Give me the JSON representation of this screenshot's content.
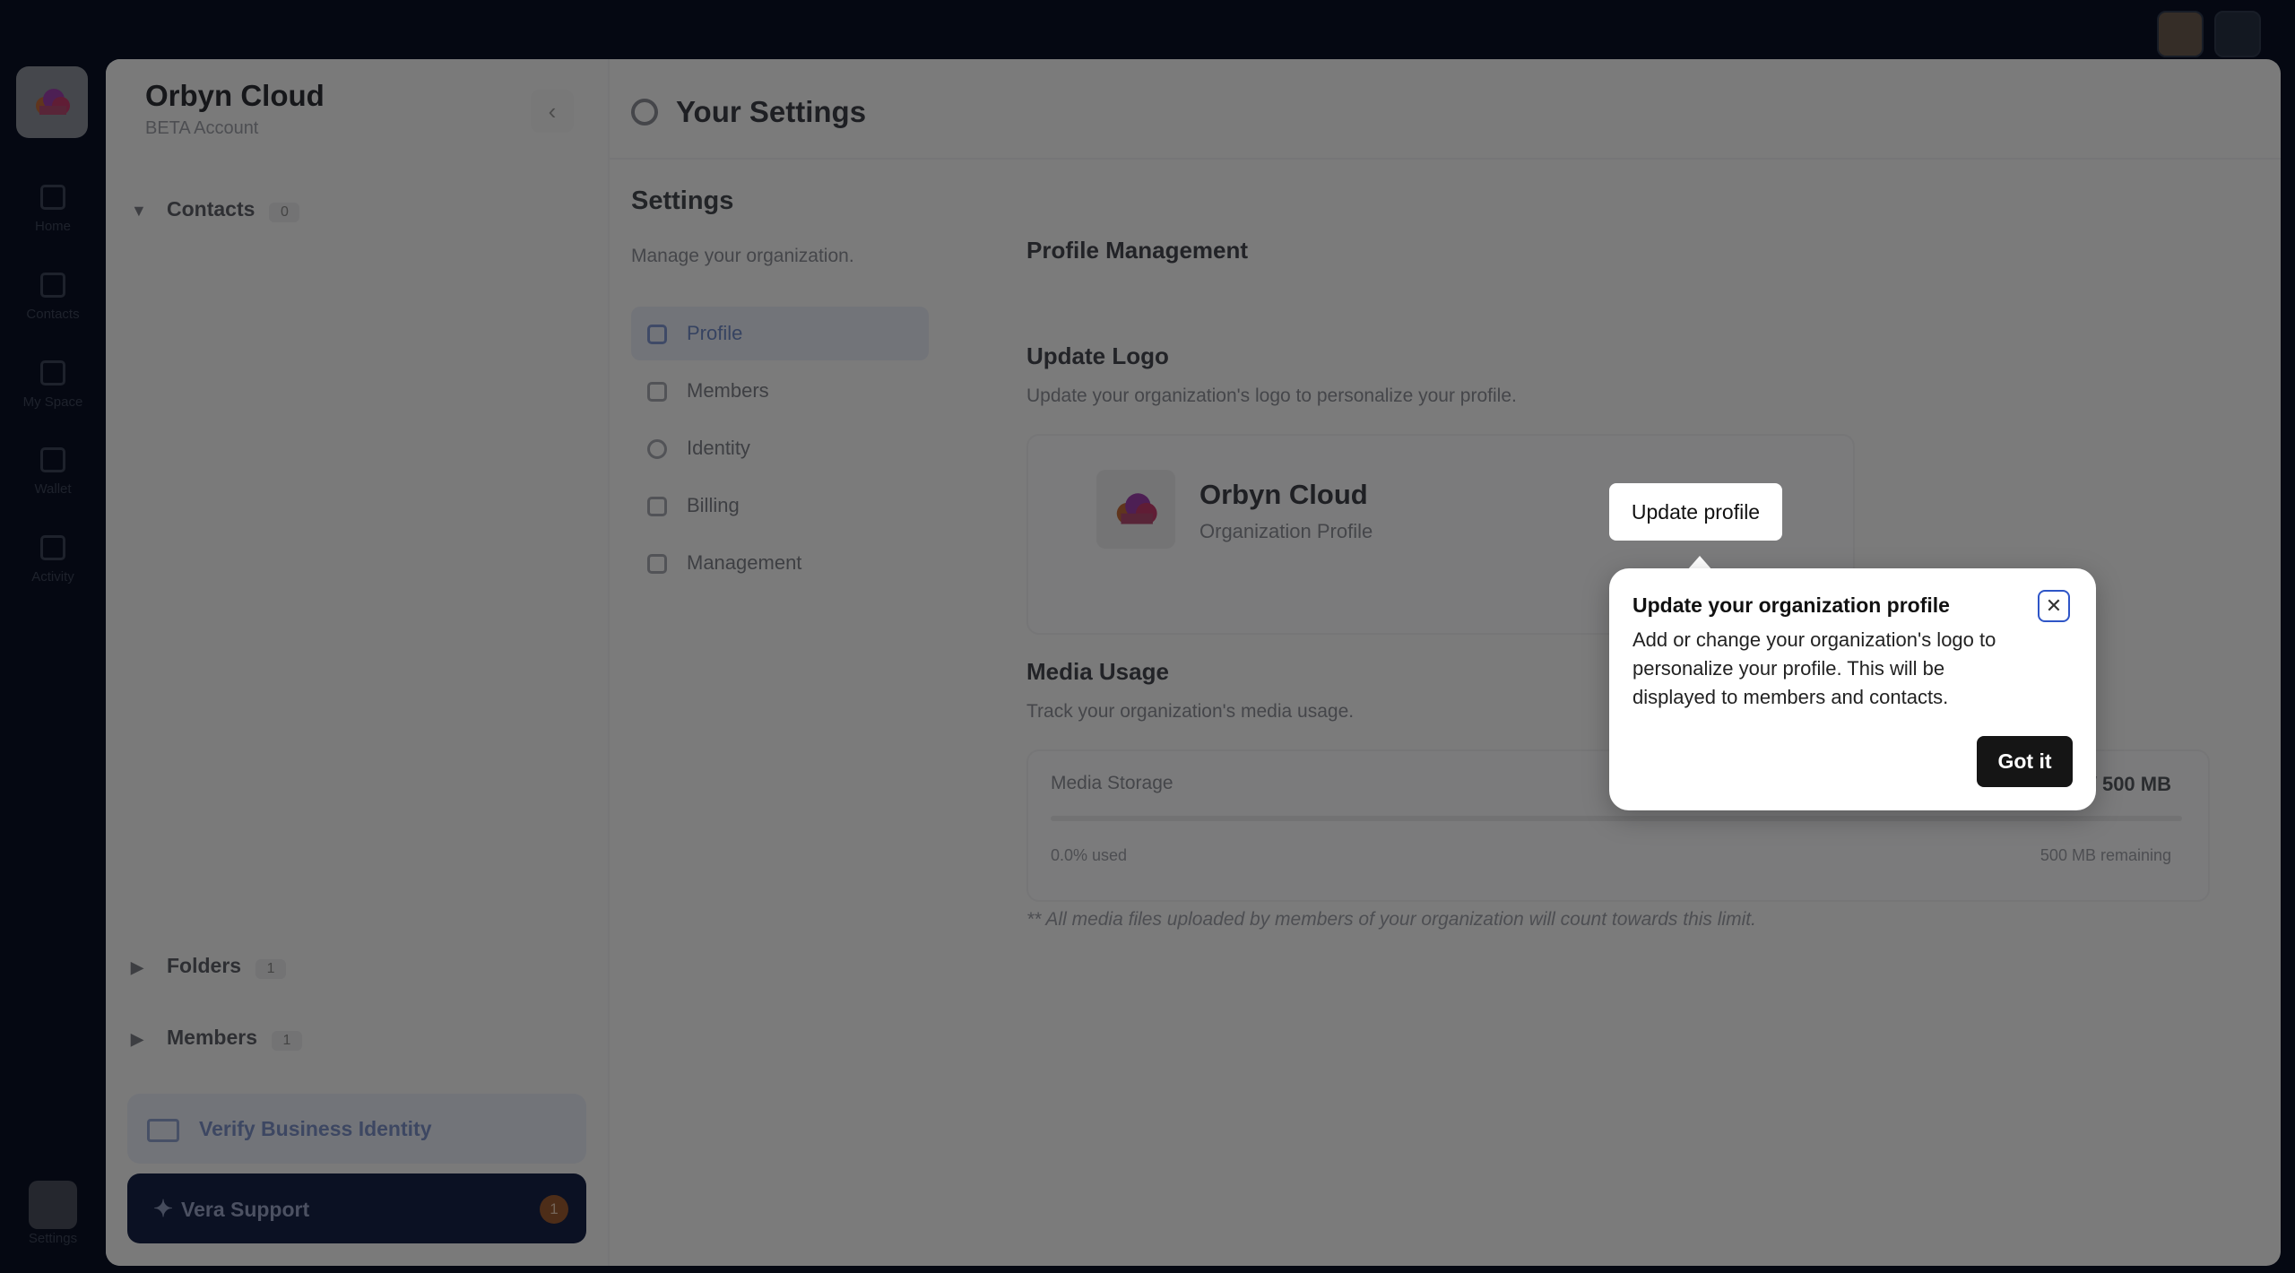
{
  "colors": {
    "rail_bg": "#0b1124",
    "accent": "#2e55c7",
    "support_bg": "#172246",
    "button_dark": "#151515",
    "overlay": "rgba(0,0,0,0.5)"
  },
  "rail": {
    "items": [
      {
        "label": "Home",
        "icon": "home-icon"
      },
      {
        "label": "Contacts",
        "icon": "contacts-icon"
      },
      {
        "label": "My Space",
        "icon": "grid-icon"
      },
      {
        "label": "Wallet",
        "icon": "wallet-icon"
      },
      {
        "label": "Activity",
        "icon": "activity-icon"
      }
    ],
    "settings_label": "Settings"
  },
  "org": {
    "name": "Orbyn Cloud",
    "account_type": "BETA Account"
  },
  "tree": {
    "contacts": {
      "label": "Contacts",
      "count": "0"
    },
    "folders": {
      "label": "Folders",
      "count": "1"
    },
    "members": {
      "label": "Members",
      "count": "1"
    }
  },
  "verify": {
    "label": "Verify Business Identity"
  },
  "support": {
    "label": "Vera Support",
    "badge": "1"
  },
  "page": {
    "title": "Your Settings"
  },
  "settings": {
    "heading": "Settings",
    "subtitle": "Manage your organization.",
    "menu": [
      {
        "label": "Profile",
        "active": true
      },
      {
        "label": "Members"
      },
      {
        "label": "Identity"
      },
      {
        "label": "Billing"
      },
      {
        "label": "Management"
      }
    ]
  },
  "profile": {
    "heading": "Profile Management",
    "logo_heading": "Update Logo",
    "logo_sub": "Update your organization's logo to personalize your profile.",
    "card_name": "Orbyn Cloud",
    "card_sub": "Organization Profile"
  },
  "media": {
    "heading": "Media Usage",
    "sub": "Track your organization's media usage.",
    "label": "Media Storage",
    "amount": "/ 500 MB",
    "used_fraction": 0.0,
    "used_text": "0.0% used",
    "remaining_text": "500 MB remaining",
    "note": "** All media files uploaded by members of your organization will count towards this limit."
  },
  "tour": {
    "highlight_label": "Update profile",
    "title": "Update your organization profile",
    "body": "Add or change your organization's logo to personalize your profile. This will be displayed to members and contacts.",
    "button": "Got it",
    "close_icon": "close-icon"
  }
}
